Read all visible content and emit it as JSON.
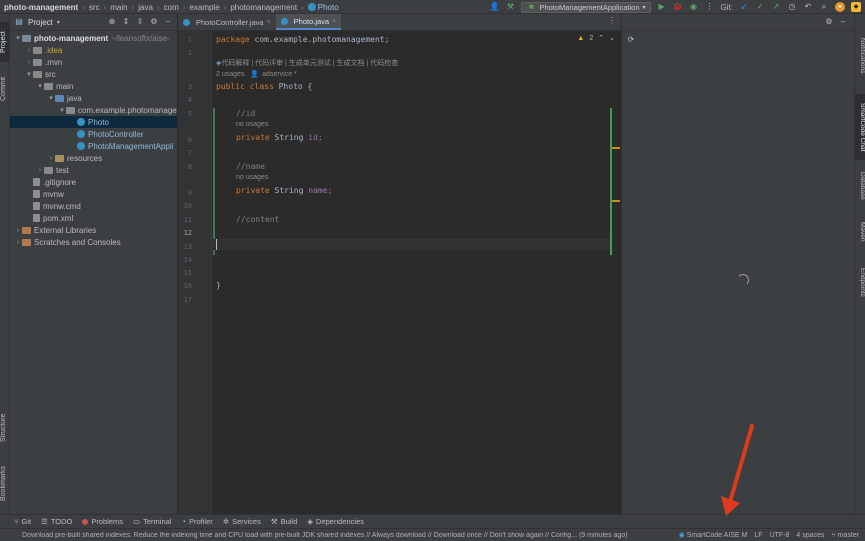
{
  "navbar": {
    "project": "photo-management",
    "crumbs": [
      "src",
      "main",
      "java",
      "com",
      "example",
      "photomanagement"
    ],
    "class_name": "Photo"
  },
  "runbar": {
    "config": "PhotoManagementApplication",
    "git_label": "Git:"
  },
  "left_tools": {
    "project": "Project",
    "commit": "Commit",
    "structure": "Structure",
    "bookmarks": "Bookmarks"
  },
  "project_panel": {
    "title": "Project",
    "tree": [
      {
        "label": "photo-management",
        "extra": "~/leansoftx/aise-",
        "level": 0,
        "expanded": true,
        "kind": "module",
        "bold": true
      },
      {
        "label": ".idea",
        "level": 1,
        "expanded": false,
        "kind": "folder"
      },
      {
        "label": ".mvn",
        "level": 1,
        "expanded": false,
        "kind": "folder"
      },
      {
        "label": "src",
        "level": 1,
        "expanded": true,
        "kind": "folder"
      },
      {
        "label": "main",
        "level": 2,
        "expanded": true,
        "kind": "folder"
      },
      {
        "label": "java",
        "level": 3,
        "expanded": true,
        "kind": "src"
      },
      {
        "label": "com.example.photomanage",
        "level": 4,
        "expanded": true,
        "kind": "folder"
      },
      {
        "label": "Photo",
        "level": 5,
        "kind": "class",
        "selected": true
      },
      {
        "label": "PhotoController",
        "level": 5,
        "kind": "class"
      },
      {
        "label": "PhotoManagementAppli",
        "level": 5,
        "kind": "class"
      },
      {
        "label": "resources",
        "level": 3,
        "expanded": false,
        "kind": "res"
      },
      {
        "label": "test",
        "level": 2,
        "expanded": false,
        "kind": "folder"
      },
      {
        "label": ".gitignore",
        "level": 1,
        "kind": "file"
      },
      {
        "label": "mvnw",
        "level": 1,
        "kind": "file"
      },
      {
        "label": "mvnw.cmd",
        "level": 1,
        "kind": "file"
      },
      {
        "label": "pom.xml",
        "level": 1,
        "kind": "file"
      },
      {
        "label": "External Libraries",
        "level": 0,
        "expanded": false,
        "kind": "ex"
      },
      {
        "label": "Scratches and Consoles",
        "level": 0,
        "expanded": false,
        "kind": "ex"
      }
    ]
  },
  "editor": {
    "tabs": [
      {
        "label": "PhotoController.java",
        "active": false
      },
      {
        "label": "Photo.java",
        "active": true
      }
    ],
    "warnings": "2",
    "line_numbers": [
      "1",
      "2",
      "3",
      "4",
      "5",
      "6",
      "7",
      "8",
      "9",
      "10",
      "11",
      "12",
      "13",
      "14",
      "15",
      "16",
      "17"
    ],
    "current_line": "12",
    "hint_actions": "代码解释 | 代码评审 | 生成单元测试 | 生成文档 | 代码检查",
    "usages_2": "2 usages",
    "author": "adservice *",
    "no_usages": "no usages",
    "code": {
      "l1_kw": "package",
      "l1_rest": " com.example.photomanagement;",
      "l3_kw": "public class",
      "l3_rest": " Photo {",
      "l5": "//id",
      "l6_kw": "private",
      "l6_type": " String ",
      "l6_field": "id",
      "l6_end": ";",
      "l8": "//name",
      "l9_kw": "private",
      "l9_type": " String ",
      "l9_field": "name",
      "l9_end": ";",
      "l11": "//content",
      "l17": "}"
    }
  },
  "right_tools": {
    "notifications": "Notifications",
    "smartcode": "SmartCode Chat",
    "database": "Database",
    "maven": "Maven",
    "endpoints": "Endpoints"
  },
  "bottom_tools": [
    "Git",
    "TODO",
    "Problems",
    "Terminal",
    "Profiler",
    "Services",
    "Build",
    "Dependencies"
  ],
  "status": {
    "message": "Download pre-built shared indexes: Reduce the indexing time and CPU load with pre-built JDK shared indexes // Always download // Download once // Don't show again // Config... (9 minutes ago)",
    "plugin": "SmartCode AISE M",
    "line_sep": "LF",
    "encoding": "UTF-8",
    "indent": "4 spaces",
    "branch": "master"
  },
  "colors": {
    "accent": "#4a88c7",
    "arrow": "#e03a1e",
    "selection": "#0d293e"
  }
}
